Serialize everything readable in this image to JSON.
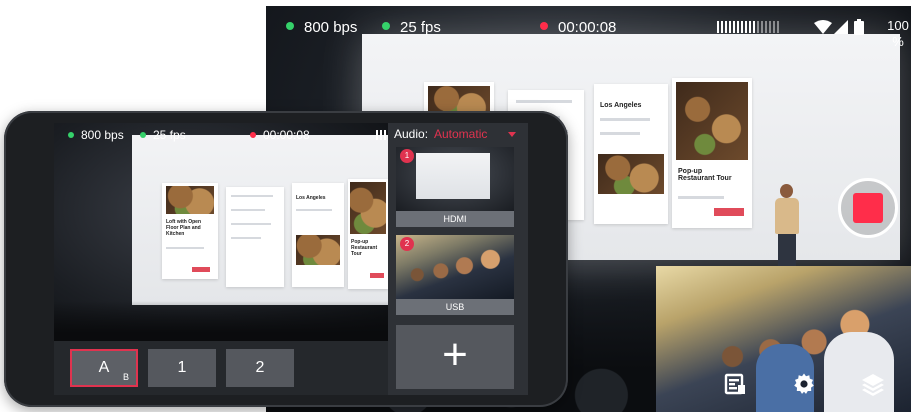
{
  "back_device": {
    "status": {
      "bitrate": "800 bps",
      "framerate": "25 fps",
      "timer": "00:00:08",
      "battery": "100\n%"
    },
    "icons": [
      "wifi-icon",
      "signal-icon",
      "battery-icon",
      "audio-meter-icon",
      "record-icon",
      "scenes-list-icon",
      "settings-gear-icon",
      "layers-icon"
    ],
    "projection": {
      "city": "Los Angeles",
      "event": "Pop-up Restaurant Tour"
    }
  },
  "front_phone": {
    "status": {
      "bitrate": "800 bps",
      "framerate": "25 fps",
      "timer": "00:00:08"
    },
    "projection": {
      "card1": "Loft with Open Floor Plan and Kitchen",
      "city": "Los Angeles",
      "event": "Pop-up Restaurant Tour"
    },
    "audio": {
      "label": "Audio:",
      "value": "Automatic"
    },
    "sources": [
      {
        "badge": "1",
        "label": "HDMI"
      },
      {
        "badge": "2",
        "label": "USB"
      }
    ],
    "add_source_label": "+",
    "scenes": [
      {
        "label": "A",
        "sub": "B",
        "active": true
      },
      {
        "label": "1",
        "sub": "",
        "active": false
      },
      {
        "label": "2",
        "sub": "",
        "active": false
      }
    ]
  },
  "colors": {
    "accent": "#e0334f",
    "live_dot": "#35d16a",
    "record_red": "#ff2d4a"
  }
}
